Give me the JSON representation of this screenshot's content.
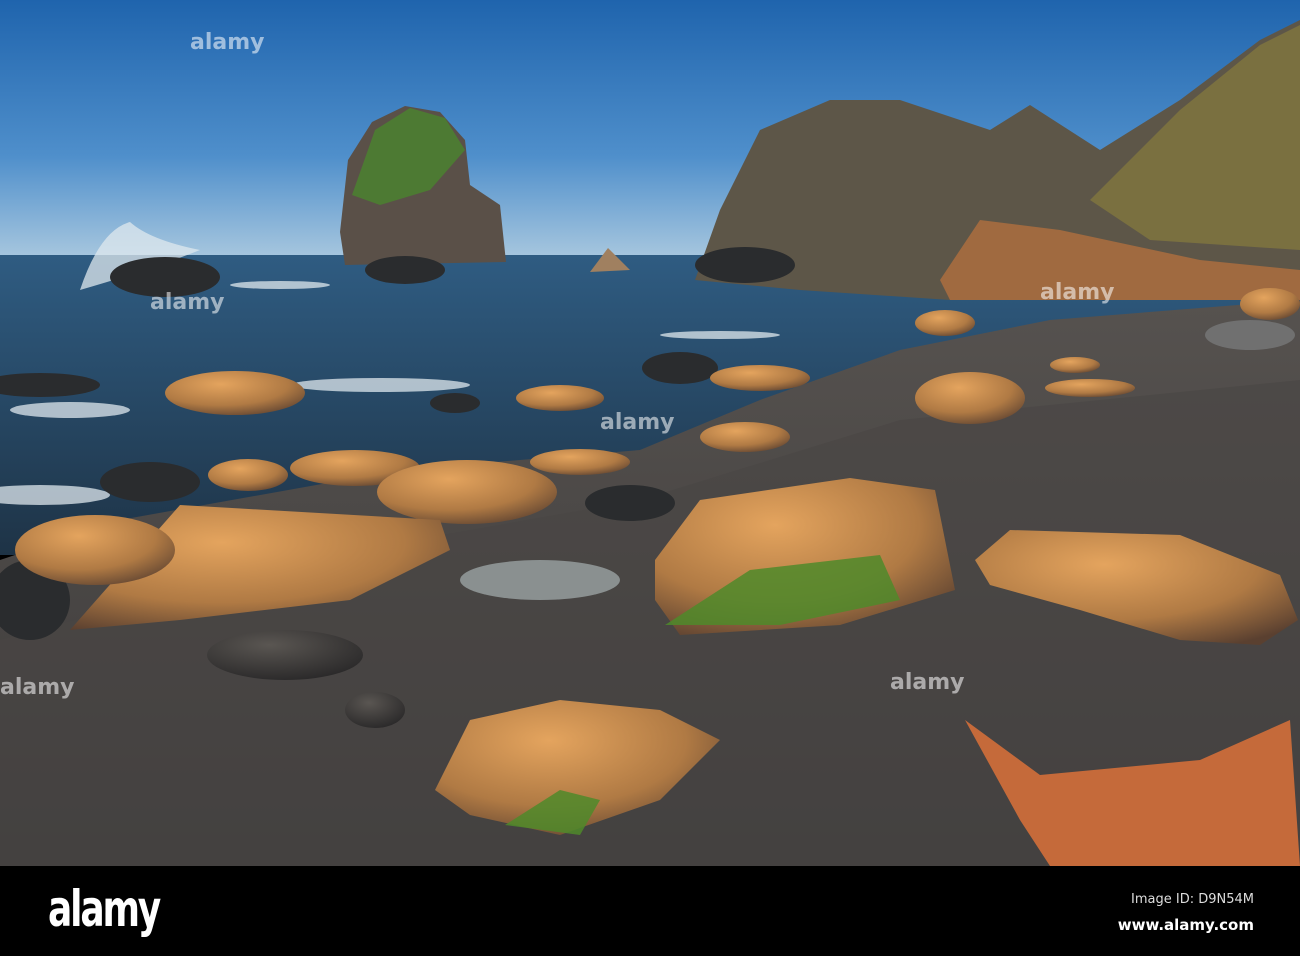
{
  "photo": {
    "subject": "rocky beach with sea stacks"
  },
  "watermark": {
    "overlay_text": "alamy"
  },
  "footer": {
    "logo": "alamy",
    "image_id": "Image ID: D9N54M",
    "url": "www.alamy.com"
  }
}
